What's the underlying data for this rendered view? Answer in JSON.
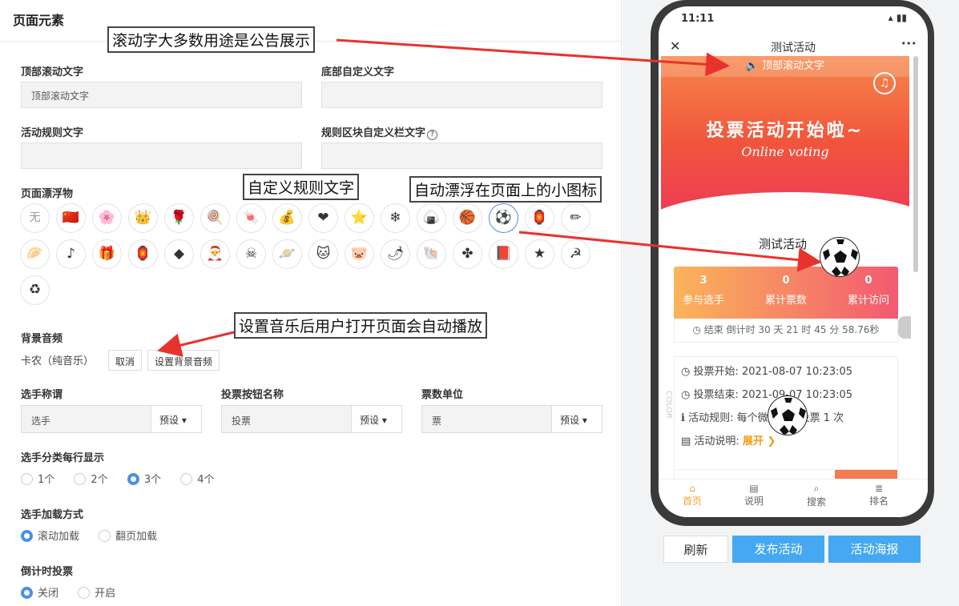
{
  "header": {
    "title": "页面元素"
  },
  "fields": {
    "top_scroll_label": "顶部滚动文字",
    "top_scroll_value": "顶部滚动文字",
    "bottom_custom_label": "底部自定义文字",
    "rules_label": "活动规则文字",
    "rules_block_label": "规则区块自定义栏文字",
    "help_icon_text": "?"
  },
  "float": {
    "label": "页面漂浮物",
    "none_label": "无",
    "icons": [
      "flag",
      "flower",
      "crown",
      "rose",
      "lollipop",
      "candy",
      "ingot",
      "heart",
      "star",
      "snowflake",
      "zongzi",
      "basketball",
      "soccer",
      "lantern",
      "pencil",
      "sausage",
      "music-note",
      "gift",
      "red-lantern",
      "fu-diamond",
      "santa",
      "skull",
      "planet",
      "cat",
      "pig",
      "chili",
      "shell",
      "knot",
      "book",
      "red-star",
      "hammer-sickle",
      "recycle"
    ]
  },
  "music": {
    "label": "背景音频",
    "current": "卡农（纯音乐）",
    "cancel": "取消",
    "set": "设置背景音频"
  },
  "naming": [
    {
      "label": "选手称谓",
      "value": "选手",
      "preset": "预设"
    },
    {
      "label": "投票按钮名称",
      "value": "投票",
      "preset": "预设"
    },
    {
      "label": "票数单位",
      "value": "票",
      "preset": "预设"
    }
  ],
  "per_row": {
    "label": "选手分类每行显示",
    "options": [
      "1个",
      "2个",
      "3个",
      "4个"
    ],
    "selected": "3个"
  },
  "load_mode": {
    "label": "选手加载方式",
    "options": [
      "滚动加载",
      "翻页加载"
    ],
    "selected": "滚动加载"
  },
  "countdown_vote": {
    "label": "倒计时投票",
    "options": [
      "关闭",
      "开启"
    ],
    "selected": "关闭"
  },
  "annotations": {
    "a1": "滚动字大多数用途是公告展示",
    "a2": "自定义规则文字",
    "a3": "自动漂浮在页面上的小图标",
    "a4": "设置音乐后用户打开页面会自动播放"
  },
  "phone": {
    "time": "11:11",
    "title": "测试活动",
    "close": "✕",
    "more": "•••",
    "ticker": "🔈 顶部滚动文字",
    "banner_title": "投票活动开始啦~",
    "banner_sub": "Online voting",
    "activity_name": "测试活动",
    "stats": [
      {
        "n": "3",
        "label": "参与选手"
      },
      {
        "n": "0",
        "label": "累计票数"
      },
      {
        "n": "0",
        "label": "累计访问"
      }
    ],
    "countdown": "◷ 结束 倒计时 30 天 21 时 45 分 58.76秒",
    "info": [
      "◷ 投票开始:  2021-08-07 10:23:05",
      "◷ 投票结束:  2021-09-07 10:23:05",
      "ℹ 活动规则:  每个微信可以投票 1 次",
      "▤ 活动说明: "
    ],
    "expand": "展开 ❯",
    "side_text": "COLOR",
    "tabs": [
      {
        "icon": "⌂",
        "label": "首页"
      },
      {
        "icon": "▤",
        "label": "说明"
      },
      {
        "icon": "⌕",
        "label": "搜索"
      },
      {
        "icon": "≣",
        "label": "排名"
      }
    ]
  },
  "preview_buttons": {
    "refresh": "刷新",
    "publish": "发布活动",
    "poster": "活动海报"
  },
  "colors": {
    "accent": "#4a90e2",
    "primary_button": "#44a8f2",
    "banner_orange": "#f7874a",
    "banner_red": "#ee3b56",
    "arrow": "#e8322d"
  }
}
